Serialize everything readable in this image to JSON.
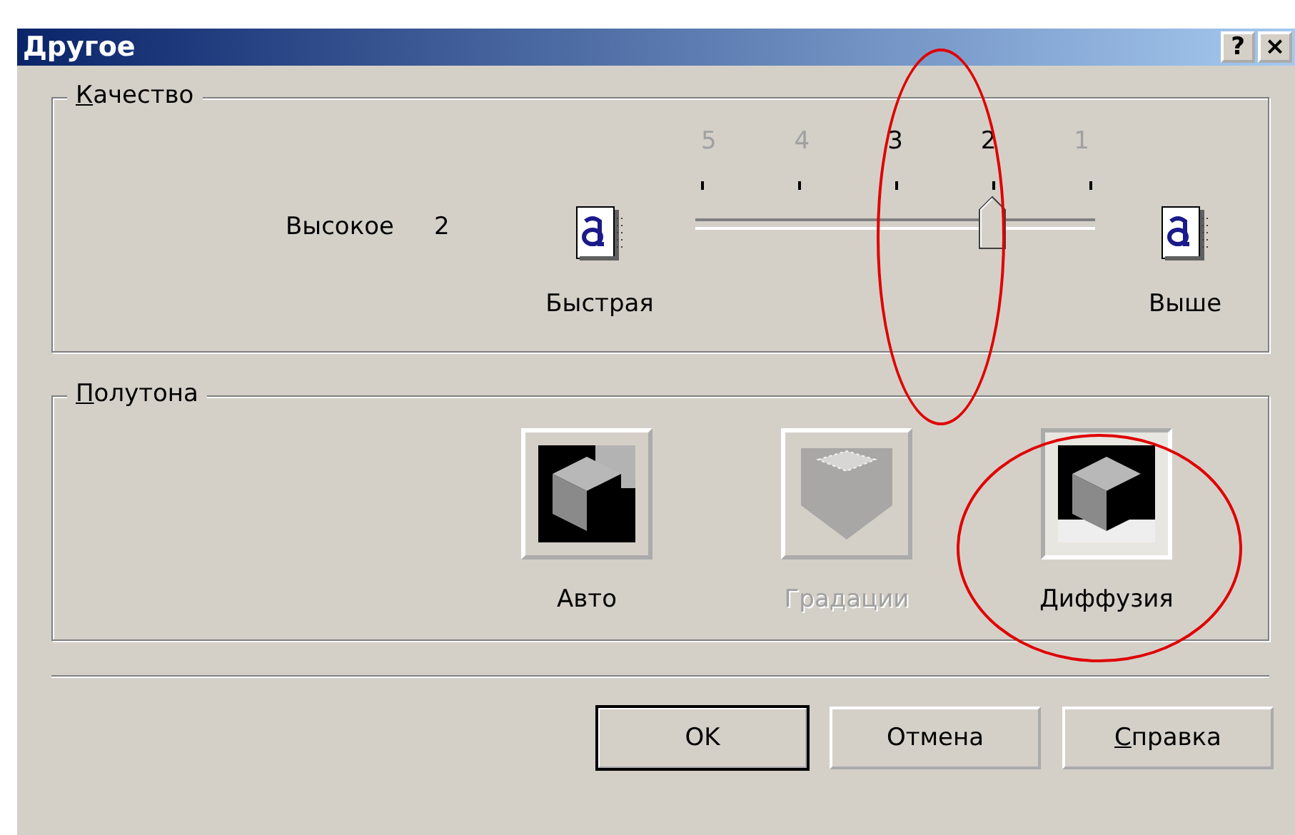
{
  "window": {
    "title": "Другое",
    "help_button": "?",
    "close_button": "×"
  },
  "quality": {
    "title": "Качество",
    "title_underlined_first": true,
    "label": "Высокое",
    "value": "2",
    "left_caption": "Быстрая",
    "right_caption": "Выше",
    "level": 0.75,
    "ticks": [
      {
        "label": "5",
        "dim": true
      },
      {
        "label": "4",
        "dim": true
      },
      {
        "label": "3",
        "dim": false
      },
      {
        "label": "2",
        "dim": false
      },
      {
        "label": "1",
        "dim": true
      }
    ]
  },
  "halftone": {
    "title": "Полутона",
    "title_underlined_first": true,
    "options": [
      {
        "label": "Авто",
        "kind": "auto",
        "selected": false,
        "disabled": false
      },
      {
        "label": "Градации",
        "kind": "gradation",
        "selected": false,
        "disabled": true
      },
      {
        "label": "Диффузия",
        "kind": "diffusion",
        "selected": true,
        "disabled": false
      }
    ]
  },
  "buttons": [
    {
      "label": "OK",
      "default": true,
      "underlined_first": false
    },
    {
      "label": "Отмена",
      "default": false,
      "underlined_first": false
    },
    {
      "label": "Справка",
      "default": false,
      "underlined_first": true
    }
  ]
}
